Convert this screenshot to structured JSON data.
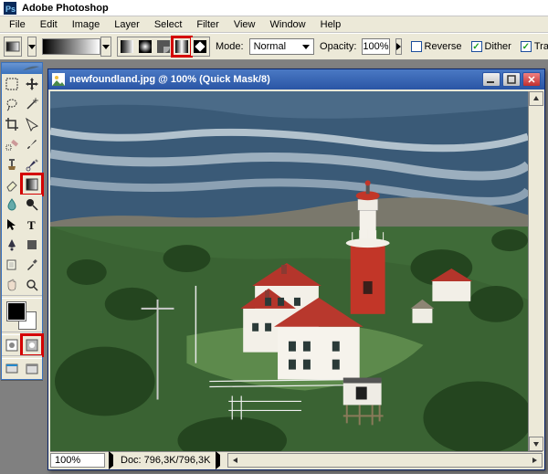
{
  "app": {
    "title": "Adobe Photoshop"
  },
  "menu": {
    "file": "File",
    "edit": "Edit",
    "image": "Image",
    "layer": "Layer",
    "select": "Select",
    "filter": "Filter",
    "view": "View",
    "window": "Window",
    "help": "Help"
  },
  "options": {
    "mode_label": "Mode:",
    "mode_value": "Normal",
    "opacity_label": "Opacity:",
    "opacity_value": "100%",
    "reverse_label": "Reverse",
    "reverse_checked": false,
    "dither_label": "Dither",
    "dither_checked": true,
    "transparency_label": "Transparency",
    "transparency_checked": true
  },
  "document": {
    "title": "newfoundland.jpg @ 100% (Quick Mask/8)",
    "zoom": "100%",
    "doc_size": "Doc: 796,3K/796,3K"
  },
  "colors": {
    "highlight": "#d40000",
    "titlebar_start": "#4a79c4",
    "titlebar_end": "#2a55a5"
  }
}
